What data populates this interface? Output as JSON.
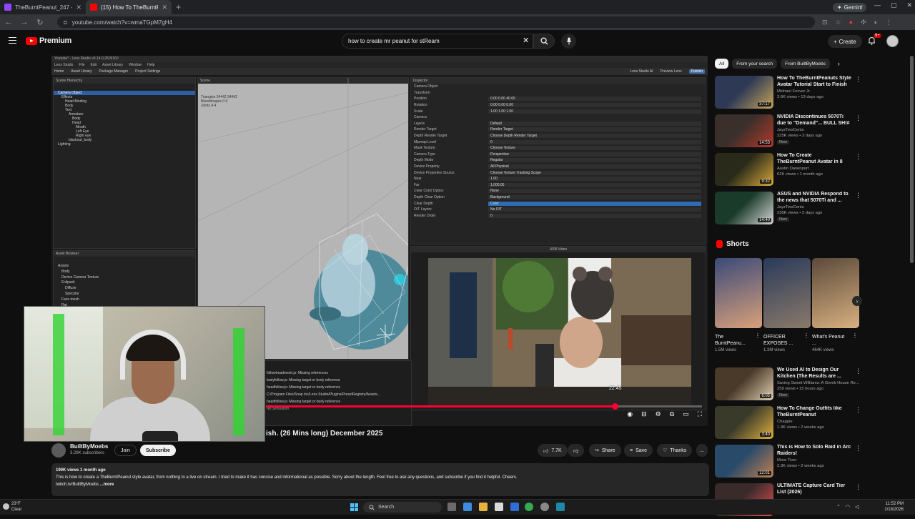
{
  "browser": {
    "tabs": [
      {
        "title": "TheBurntPeanut_247 - Twitch",
        "color": "#9146ff",
        "active": false
      },
      {
        "title": "(15) How To TheBurntPeanut...",
        "color": "#ff0000",
        "active": true
      }
    ],
    "new_tab": "+",
    "gemini_label": "Gemini",
    "url": "youtube.com/watch?v=wmaTGpM7gH4"
  },
  "youtube": {
    "logo_text": "Premium",
    "search": {
      "value": "how to create mr peanut for stReam",
      "placeholder": "Search"
    },
    "create_label": "Create",
    "notifications_count": "9+"
  },
  "player": {
    "lens_studio": {
      "window_title": "Youtube* - Lens Studio v5.14.0.2509160",
      "menu": [
        "Lens Studio",
        "File",
        "Edit",
        "Asset Library",
        "Window",
        "Help"
      ],
      "toolbar": [
        "Home",
        "Asset Library",
        "Package Manager",
        "Project Settings"
      ],
      "toolbar_right": [
        "Lens Studio AI",
        "Preview Lens",
        "Publish"
      ],
      "hierarchy_title": "Scene Hierarchy",
      "hierarchy": [
        "Camera Object",
        "Effects",
        "Head Binding",
        "Body",
        "Text",
        "Armature",
        "Body",
        "Head",
        "Mouth",
        "Left Eye",
        "Right eye",
        "blackout_body",
        "Lighting"
      ],
      "assets_title": "Asset Browser",
      "assets": [
        "Assets",
        "Body",
        "Device Camera Texture",
        "Eclipsek",
        "Diffuse",
        "Specular",
        "Face mesh",
        "Rat"
      ],
      "scene_title": "Scene",
      "scene_tabs": [
        "Parent Space",
        "Color Highlight",
        "Run Script"
      ],
      "scene_stats": [
        "Triangles  34442  34442",
        "Blendshapes  0  0",
        "Joints  4  4"
      ],
      "inspector_title": "Inspector",
      "inspector_rows": [
        {
          "label": "Camera Object",
          "value": ""
        },
        {
          "label": "Transform",
          "value": ""
        },
        {
          "label": "Position",
          "value": "0.00   0.00   40.00"
        },
        {
          "label": "Rotation",
          "value": "0.00   0.00   0.00"
        },
        {
          "label": "Scale",
          "value": "1.00   1.00   1.00"
        },
        {
          "label": "Camera",
          "value": ""
        },
        {
          "label": "Layers",
          "value": "Default"
        },
        {
          "label": "Render Target",
          "value": "Render Target"
        },
        {
          "label": "Depth Render Target",
          "value": "Choose Depth Render Target"
        },
        {
          "label": "Mipmap Level",
          "value": "0"
        },
        {
          "label": "Mask Texture",
          "value": "Choose Texture"
        },
        {
          "label": "Camera Type",
          "value": "Perspective"
        },
        {
          "label": "Depth Mode",
          "value": "Regular"
        },
        {
          "label": "Device Property",
          "value": "All Physical"
        },
        {
          "label": "Device Properties Source",
          "value": "Choose Texture Tracking Scope"
        },
        {
          "label": "Near",
          "value": "1.00"
        },
        {
          "label": "Far",
          "value": "1,000.00"
        },
        {
          "label": "Clear Color Option",
          "value": "None"
        },
        {
          "label": "Depth Clear Option",
          "value": "Background"
        },
        {
          "label": "Clear Depth",
          "value": "Color"
        },
        {
          "label": "OIT Layers",
          "value": "No OIT"
        },
        {
          "label": "Render Order",
          "value": "0"
        }
      ],
      "preview_mode": "USB Video",
      "log_lines": [
        "followheadmesh.js: Missing references",
        "bodyfollow.js: Missing target or body reference",
        "headfollow.js: Missing target or body reference",
        "C:/Program Files/Snap Inc/Lens Studio/Plugins/PresetRegistry/Assets...",
        "headfollow.js: Missing target or body reference"
      ],
      "simulation_label": "No Simulation"
    },
    "progress": 0.8,
    "time_tooltip": "22:45"
  },
  "video": {
    "title_visible": "ish. (26 Mins long) December 2025",
    "channel": "BuiltByMoebs",
    "subscribers": "3.29K subscribers",
    "join_label": "Join",
    "subscribe_label": "Subscribe",
    "likes": "7.7K",
    "share_label": "Share",
    "save_label": "Save",
    "thanks_label": "Thanks",
    "more_actions": "...",
    "views_date": "190K views  1 month ago",
    "description": "This is how to create a TheBurntPeanut style avatar, from nothing to a live on stream. I tried to make it has concise and informational as possible. Sorry about the length. Feel free to ask any questions, and subscribe if you find it helpful. Cheers.",
    "description_link": "twitch.tv/BuiltByMoebs",
    "more_label": "...more"
  },
  "sidebar": {
    "chips": [
      "All",
      "From your search",
      "From BuiltByMoebs"
    ],
    "recommendations": [
      {
        "title": "How To TheBurntPeanuts Style Avatar Tutorial Start to Finish",
        "channel": "Michael Fevver Jr.",
        "meta": "3.6K views • 13 days ago",
        "badge": "",
        "duration": "37:17",
        "colors": [
          "#2e3a55",
          "#c7a45a"
        ]
      },
      {
        "title": "NVIDIA Discontinues 5070Ti due to \"Demand\"... BULL SH!#",
        "channel": "JayzTwoCents",
        "meta": "325K views • 3 days ago",
        "badge": "New",
        "duration": "14:53",
        "colors": [
          "#3a2f2a",
          "#b23a2a"
        ]
      },
      {
        "title": "How To Create TheBurntPeanut Avatar in 8 Minutes (No ...",
        "channel": "Austin Davenport",
        "meta": "62K views • 1 month ago",
        "badge": "",
        "duration": "9:32",
        "colors": [
          "#2a2a1a",
          "#d6a83a"
        ]
      },
      {
        "title": "ASUS and NVIDIA Respond to the news that 5070Ti and ...",
        "channel": "JayzTwoCents",
        "meta": "235K views • 2 days ago",
        "badge": "New",
        "duration": "14:40",
        "colors": [
          "#1a3a2a",
          "#d8d8d8"
        ]
      }
    ],
    "shorts_title": "Shorts",
    "shorts": [
      {
        "title": "The BurntPeanu...",
        "views": "1.5M views",
        "colors": [
          "#3a4a7a",
          "#d9a07a"
        ]
      },
      {
        "title": "OFFICER EXPOSES ...",
        "views": "1.3M views",
        "colors": [
          "#2a3a5a",
          "#8a7a6a"
        ]
      },
      {
        "title": "What's Peanut ...",
        "views": "464K views",
        "colors": [
          "#5a4a3a",
          "#d9b080"
        ]
      }
    ],
    "recommendations2": [
      {
        "title": "We Used AI to Design Our Kitchen (The Results are ...",
        "channel": "Saving Sweet Williams: A Greek House Re...",
        "meta": "259 views • 15 hours ago",
        "badge": "New",
        "duration": "6:05",
        "colors": [
          "#4a3a2a",
          "#e0d0b0"
        ]
      },
      {
        "title": "How To Change Outfits like TheBurntPeanut",
        "channel": "Chappie",
        "meta": "1.3K views • 2 weeks ago",
        "badge": "",
        "duration": "3:40",
        "colors": [
          "#3a3a2a",
          "#e0b040"
        ]
      },
      {
        "title": "This is How to Solo Raid in Arc Raiders!",
        "channel": "More Tiver",
        "meta": "2.3K views • 2 weeks ago",
        "badge": "",
        "duration": "12:01",
        "colors": [
          "#2a4a6a",
          "#c08050"
        ]
      },
      {
        "title": "ULTIMATE Capture Card Tier List (2026)",
        "channel": "",
        "meta": "",
        "badge": "",
        "duration": "",
        "colors": [
          "#3a2a2a",
          "#e05050"
        ]
      }
    ]
  },
  "taskbar": {
    "weather_temp": "23°F",
    "weather_cond": "Clear",
    "search_label": "Search",
    "time": "11:52 PM",
    "date": "1/18/2026"
  }
}
